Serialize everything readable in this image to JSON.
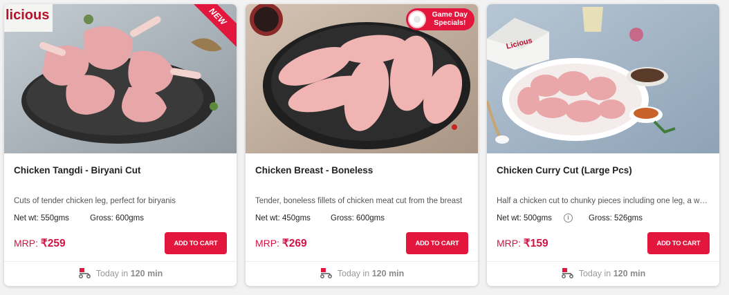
{
  "products": [
    {
      "badge": "NEW",
      "title": "Chicken Tangdi - Biryani Cut",
      "description": "Cuts of tender chicken leg, perfect for biryanis",
      "net_wt": "Net wt: 550gms",
      "gross": "Gross: 600gms",
      "mrp_label": "MRP:",
      "price": "₹259",
      "button": "ADD TO CART",
      "delivery_prefix": "Today in",
      "delivery_time": "120 min"
    },
    {
      "badge_line1": "Game Day",
      "badge_line2": "Specials!",
      "title": "Chicken Breast - Boneless",
      "description": "Tender, boneless fillets of chicken meat cut from the breast",
      "net_wt": "Net wt: 450gms",
      "gross": "Gross: 600gms",
      "mrp_label": "MRP:",
      "price": "₹269",
      "button": "ADD TO CART",
      "delivery_prefix": "Today in",
      "delivery_time": "120 min"
    },
    {
      "box_brand": "Licious",
      "title": "Chicken Curry Cut (Large Pcs)",
      "description": "Half a chicken cut to chunky pieces including one leg, a wing and breast",
      "net_wt": "Net wt: 500gms",
      "gross": "Gross: 526gms",
      "mrp_label": "MRP:",
      "price": "₹159",
      "button": "ADD TO CART",
      "delivery_prefix": "Today in",
      "delivery_time": "120 min"
    }
  ],
  "corner_text": "licious",
  "colors": {
    "accent": "#e3173e",
    "price": "#d11243"
  }
}
